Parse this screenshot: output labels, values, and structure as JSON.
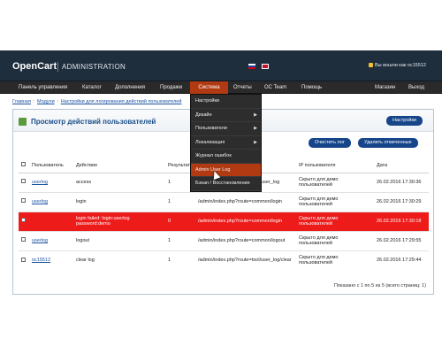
{
  "app": {
    "logo": "OpenCart",
    "title": "ADMINISTRATION",
    "login_status": "Вы вошли как oc15512"
  },
  "menu": [
    "Панель управления",
    "Каталог",
    "Дополнения",
    "Продажи",
    "Система",
    "Отчеты",
    "OC Team",
    "Помощь",
    "Магазин",
    "Выход"
  ],
  "breadcrumb": [
    "Главная",
    "Модули",
    "Настройки для логирования действий пользователей"
  ],
  "panel": {
    "title": "Просмотр действий пользователей",
    "settings_button": "Настройки"
  },
  "actions": {
    "clear_log": "Очистить лог",
    "delete_selected": "Удалить отмеченные"
  },
  "table": {
    "headers": [
      "Пользователь",
      "Действие",
      "Результат",
      "",
      "IP пользователя",
      "Дата"
    ],
    "rows": [
      {
        "user": "userlog",
        "action": "access",
        "result": "1",
        "url": "",
        "ip": "Скрыто для демо пользователей",
        "date": "26.02.2016 17:30:36",
        "error": false
      },
      {
        "user": "userlog",
        "action": "login",
        "result": "1",
        "url": "/admin/index.php?route=common/login",
        "ip": "Скрыто для демо пользователей",
        "date": "26.02.2016 17:30:29",
        "error": false
      },
      {
        "user": "",
        "action": "login failed: login:userlog password:demo",
        "result": "0",
        "url": "/admin/index.php?route=common/login",
        "ip": "Скрыто для демо пользователей",
        "date": "26.02.2016 17:30:18",
        "error": true
      },
      {
        "user": "userlog",
        "action": "logout",
        "result": "1",
        "url": "/admin/index.php?route=common/logout",
        "ip": "Скрыто для демо пользователей",
        "date": "26.02.2016 17:29:55",
        "error": false
      },
      {
        "user": "oc15512",
        "action": "clear log",
        "result": "1",
        "url": "/admin/index.php?route=tool/user_log/clear",
        "ip": "Скрыто для демо пользователей",
        "date": "26.02.2016 17:29:44",
        "error": false
      }
    ],
    "pagination": "Показано с 1 по 5 из 5 (всего страниц: 1)"
  },
  "dropdown": [
    {
      "label": "Настройки",
      "submenu": false
    },
    {
      "label": "Дизайн",
      "submenu": true
    },
    {
      "label": "Пользователи",
      "submenu": true
    },
    {
      "label": "Локализация",
      "submenu": true
    },
    {
      "label": "Журнал ошибок",
      "submenu": false
    },
    {
      "label": "Admin User Log",
      "submenu": false
    },
    {
      "label": "Бэкап / Восстановление",
      "submenu": false
    }
  ],
  "row1_url_partial": "/admin/index.php?route=tool/user_log",
  "colors": {
    "header": "#1f2e3d",
    "menu": "#2a2a2a",
    "active": "#b23a12",
    "error_row": "#ee1b1b",
    "button": "#16458a"
  },
  "icons": [
    "lock-icon",
    "flag-ru-icon",
    "flag-gb-icon",
    "panel-icon",
    "submenu-arrow-icon"
  ]
}
